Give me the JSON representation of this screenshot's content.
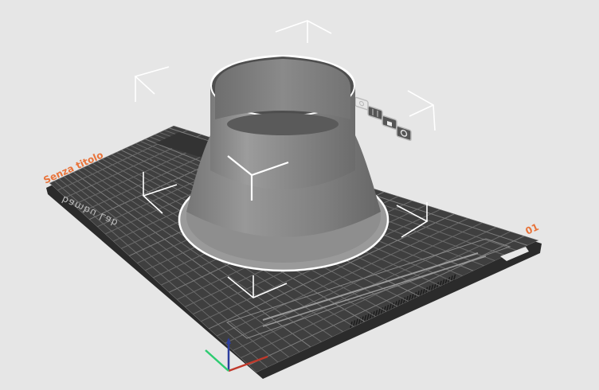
{
  "plate": {
    "name": "Senza titolo",
    "index": "01",
    "brand": "bambu Lab"
  },
  "colors": {
    "background": "#e6e6e6",
    "plate": "#3f3f3f",
    "plate_shadow": "#2b2b2b",
    "grid": "#6a6a6a",
    "label": "#e8743b",
    "model": "#8f8f8f",
    "selection": "#ffffff",
    "axis_x": "#c0392b",
    "axis_y": "#2ecc71",
    "axis_z": "#2c3e9e"
  },
  "plate_tools": [
    {
      "name": "camera-view-icon"
    },
    {
      "name": "arrange-icon"
    },
    {
      "name": "lock-icon"
    },
    {
      "name": "settings-icon"
    }
  ]
}
